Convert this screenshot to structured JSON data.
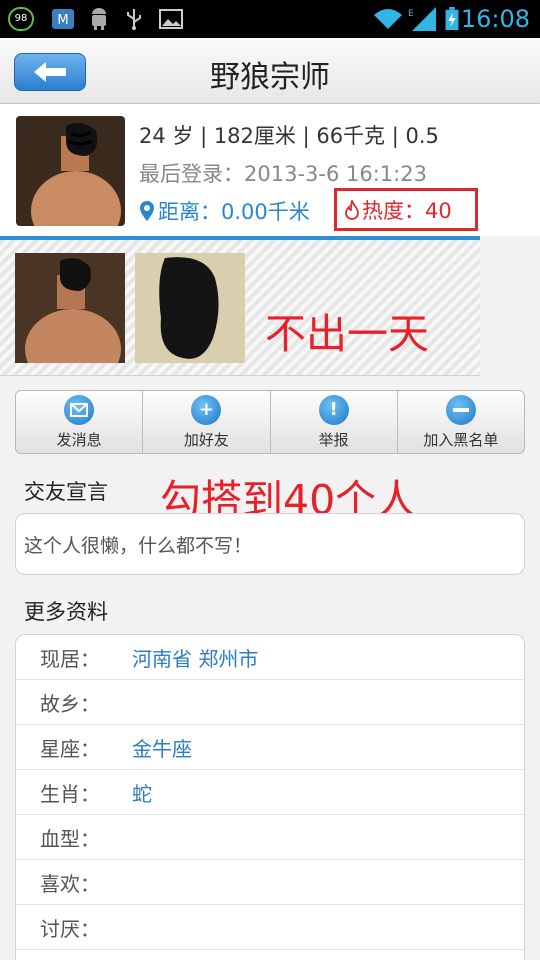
{
  "status_bar": {
    "time": "16:08",
    "badge": "98",
    "icons": [
      "battery-level-icon",
      "app-notification-icon",
      "android-icon",
      "usb-icon",
      "image-icon",
      "wifi-icon",
      "signal-icon",
      "battery-icon"
    ]
  },
  "header": {
    "title": "野狼宗师",
    "back_icon": "back-arrow-icon"
  },
  "profile": {
    "line1": "24 岁 | 182厘米 | 66千克 | 0.5",
    "line2": "最后登录：2013-3-6 16:1:23",
    "distance": "距离：0.00千米",
    "heat": "热度：40"
  },
  "annotations": {
    "photos_note": "不出一天",
    "motto_note": "勾搭到40个人"
  },
  "actions": [
    {
      "label": "发消息",
      "icon": "envelope-icon"
    },
    {
      "label": "加好友",
      "icon": "plus-icon"
    },
    {
      "label": "举报",
      "icon": "exclamation-icon"
    },
    {
      "label": "加入黑名单",
      "icon": "minus-icon"
    }
  ],
  "motto": {
    "title": "交友宣言",
    "text": "这个人很懒，什么都不写！"
  },
  "more": {
    "title": "更多资料",
    "rows": [
      {
        "key": "现居：",
        "value": "河南省 郑州市"
      },
      {
        "key": "故乡：",
        "value": ""
      },
      {
        "key": "星座：",
        "value": "金牛座"
      },
      {
        "key": "生肖：",
        "value": "蛇"
      },
      {
        "key": "血型：",
        "value": ""
      },
      {
        "key": "喜欢：",
        "value": ""
      },
      {
        "key": "讨厌：",
        "value": ""
      }
    ]
  },
  "colors": {
    "accent": "#2f8dd5",
    "annotation": "#e8202a"
  }
}
